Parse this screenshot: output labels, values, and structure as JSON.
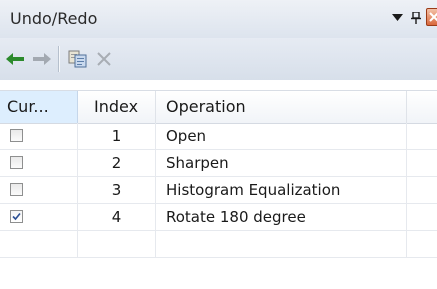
{
  "panel": {
    "title": "Undo/Redo",
    "icons": {
      "dropdown": "dropdown-arrow-icon",
      "pin": "pin-icon",
      "close": "close-icon"
    }
  },
  "toolbar": {
    "undo": {
      "icon": "arrow-left-icon",
      "enabled": true,
      "color": "#2c8a2c"
    },
    "redo": {
      "icon": "arrow-right-icon",
      "enabled": false
    },
    "copy": {
      "icon": "copy-icon",
      "enabled": true
    },
    "delete": {
      "icon": "delete-x-icon",
      "enabled": false
    }
  },
  "grid": {
    "columns": [
      "Cur...",
      "Index",
      "Operation",
      ""
    ],
    "rows": [
      {
        "current": false,
        "index": "1",
        "operation": "Open"
      },
      {
        "current": false,
        "index": "2",
        "operation": "Sharpen"
      },
      {
        "current": false,
        "index": "3",
        "operation": "Histogram Equalization"
      },
      {
        "current": true,
        "index": "4",
        "operation": "Rotate 180 degree"
      },
      {
        "current": null,
        "index": "",
        "operation": ""
      }
    ]
  }
}
